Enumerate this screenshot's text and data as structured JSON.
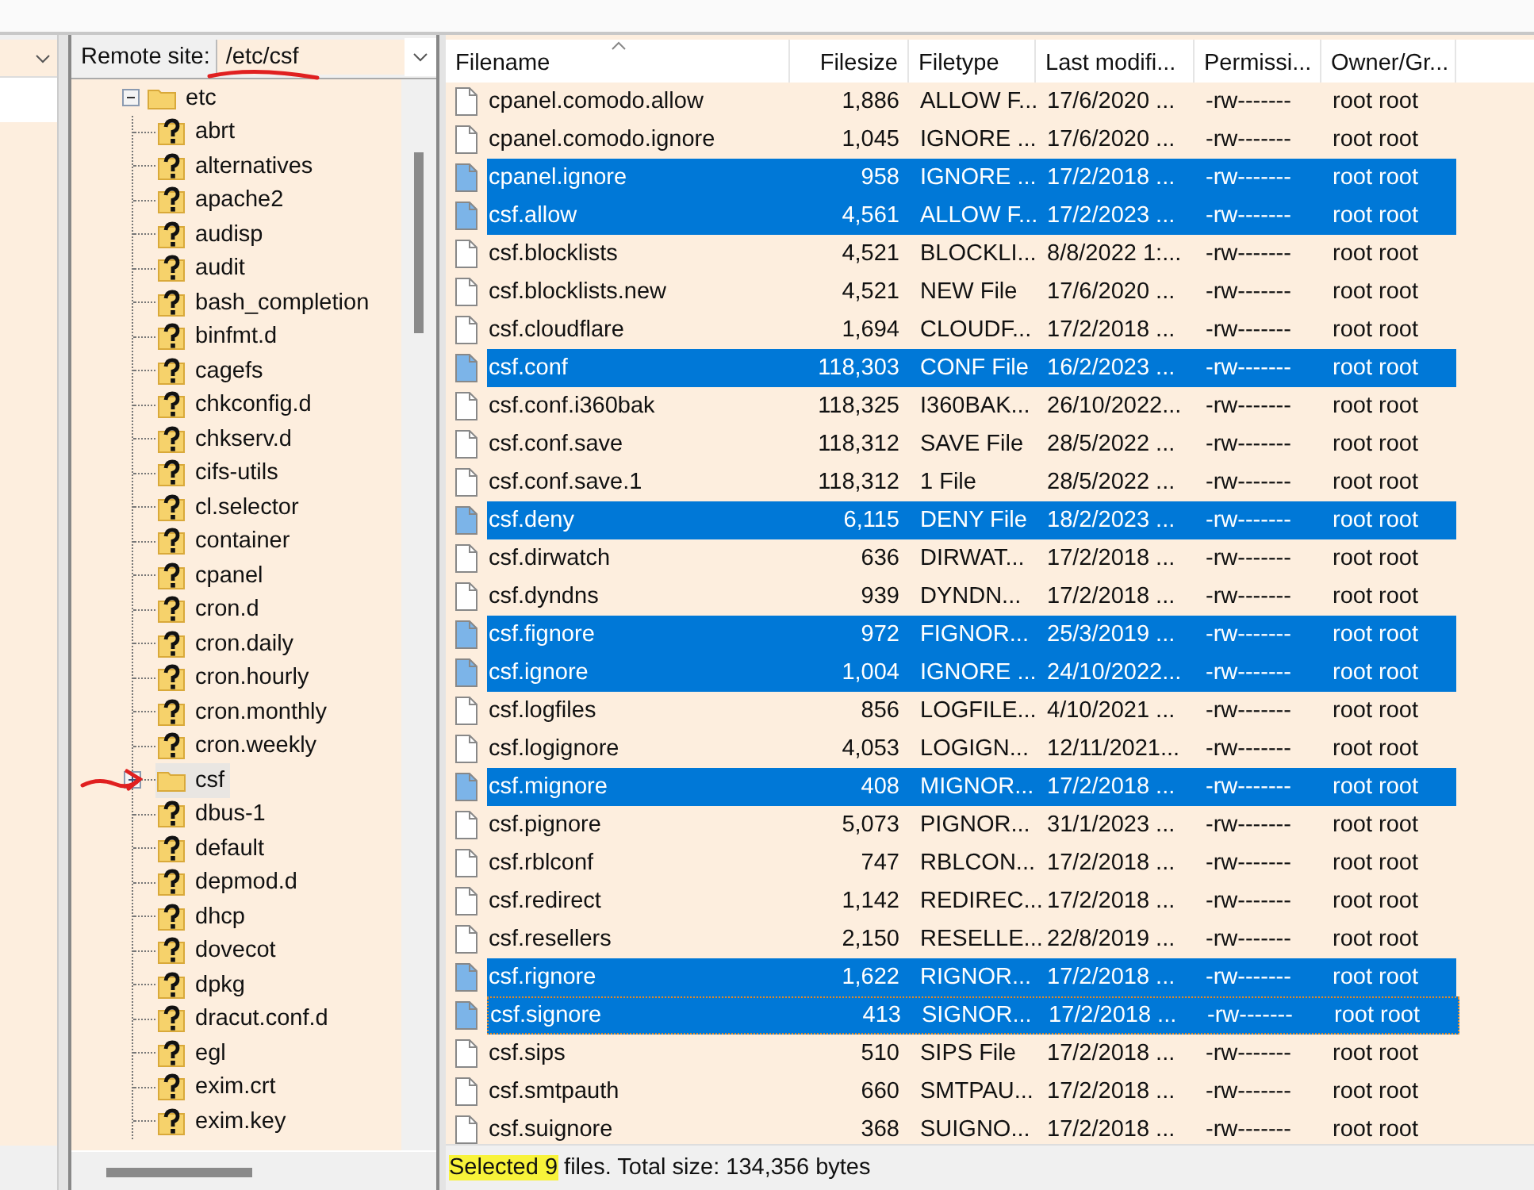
{
  "remote_panel": {
    "label": "Remote site:",
    "path": "/etc/csf",
    "tree": [
      {
        "name": "etc",
        "kind": "folder",
        "expanded": true,
        "selected": false,
        "children": [
          {
            "name": "abrt",
            "kind": "unknown"
          },
          {
            "name": "alternatives",
            "kind": "unknown"
          },
          {
            "name": "apache2",
            "kind": "unknown"
          },
          {
            "name": "audisp",
            "kind": "unknown"
          },
          {
            "name": "audit",
            "kind": "unknown"
          },
          {
            "name": "bash_completion",
            "kind": "unknown"
          },
          {
            "name": "binfmt.d",
            "kind": "unknown"
          },
          {
            "name": "cagefs",
            "kind": "unknown"
          },
          {
            "name": "chkconfig.d",
            "kind": "unknown"
          },
          {
            "name": "chkserv.d",
            "kind": "unknown"
          },
          {
            "name": "cifs-utils",
            "kind": "unknown"
          },
          {
            "name": "cl.selector",
            "kind": "unknown"
          },
          {
            "name": "container",
            "kind": "unknown"
          },
          {
            "name": "cpanel",
            "kind": "unknown"
          },
          {
            "name": "cron.d",
            "kind": "unknown"
          },
          {
            "name": "cron.daily",
            "kind": "unknown"
          },
          {
            "name": "cron.hourly",
            "kind": "unknown"
          },
          {
            "name": "cron.monthly",
            "kind": "unknown"
          },
          {
            "name": "cron.weekly",
            "kind": "unknown"
          },
          {
            "name": "csf",
            "kind": "folder",
            "expanded": false,
            "selected": true
          },
          {
            "name": "dbus-1",
            "kind": "unknown"
          },
          {
            "name": "default",
            "kind": "unknown"
          },
          {
            "name": "depmod.d",
            "kind": "unknown"
          },
          {
            "name": "dhcp",
            "kind": "unknown"
          },
          {
            "name": "dovecot",
            "kind": "unknown"
          },
          {
            "name": "dpkg",
            "kind": "unknown"
          },
          {
            "name": "dracut.conf.d",
            "kind": "unknown"
          },
          {
            "name": "egl",
            "kind": "unknown"
          },
          {
            "name": "exim.crt",
            "kind": "unknown"
          },
          {
            "name": "exim.key",
            "kind": "unknown"
          }
        ]
      }
    ]
  },
  "file_table": {
    "columns": [
      "Filename",
      "Filesize",
      "Filetype",
      "Last modifi...",
      "Permissi...",
      "Owner/Gr..."
    ],
    "rows": [
      {
        "cells": [
          "cpanel.comodo.allow",
          "1,886",
          "ALLOW F...",
          "17/6/2020 ...",
          "-rw-------",
          "root root"
        ],
        "selected": false
      },
      {
        "cells": [
          "cpanel.comodo.ignore",
          "1,045",
          "IGNORE ...",
          "17/6/2020 ...",
          "-rw-------",
          "root root"
        ],
        "selected": false
      },
      {
        "cells": [
          "cpanel.ignore",
          "958",
          "IGNORE ...",
          "17/2/2018 ...",
          "-rw-------",
          "root root"
        ],
        "selected": true
      },
      {
        "cells": [
          "csf.allow",
          "4,561",
          "ALLOW F...",
          "17/2/2023 ...",
          "-rw-------",
          "root root"
        ],
        "selected": true
      },
      {
        "cells": [
          "csf.blocklists",
          "4,521",
          "BLOCKLI...",
          "8/8/2022 1:...",
          "-rw-------",
          "root root"
        ],
        "selected": false
      },
      {
        "cells": [
          "csf.blocklists.new",
          "4,521",
          "NEW File",
          "17/6/2020 ...",
          "-rw-------",
          "root root"
        ],
        "selected": false
      },
      {
        "cells": [
          "csf.cloudflare",
          "1,694",
          "CLOUDF...",
          "17/2/2018 ...",
          "-rw-------",
          "root root"
        ],
        "selected": false
      },
      {
        "cells": [
          "csf.conf",
          "118,303",
          "CONF File",
          "16/2/2023 ...",
          "-rw-------",
          "root root"
        ],
        "selected": true
      },
      {
        "cells": [
          "csf.conf.i360bak",
          "118,325",
          "I360BAK...",
          "26/10/2022...",
          "-rw-------",
          "root root"
        ],
        "selected": false
      },
      {
        "cells": [
          "csf.conf.save",
          "118,312",
          "SAVE File",
          "28/5/2022 ...",
          "-rw-------",
          "root root"
        ],
        "selected": false
      },
      {
        "cells": [
          "csf.conf.save.1",
          "118,312",
          "1 File",
          "28/5/2022 ...",
          "-rw-------",
          "root root"
        ],
        "selected": false
      },
      {
        "cells": [
          "csf.deny",
          "6,115",
          "DENY File",
          "18/2/2023 ...",
          "-rw-------",
          "root root"
        ],
        "selected": true
      },
      {
        "cells": [
          "csf.dirwatch",
          "636",
          "DIRWAT...",
          "17/2/2018 ...",
          "-rw-------",
          "root root"
        ],
        "selected": false
      },
      {
        "cells": [
          "csf.dyndns",
          "939",
          "DYNDN...",
          "17/2/2018 ...",
          "-rw-------",
          "root root"
        ],
        "selected": false
      },
      {
        "cells": [
          "csf.fignore",
          "972",
          "FIGNOR...",
          "25/3/2019 ...",
          "-rw-------",
          "root root"
        ],
        "selected": true
      },
      {
        "cells": [
          "csf.ignore",
          "1,004",
          "IGNORE ...",
          "24/10/2022...",
          "-rw-------",
          "root root"
        ],
        "selected": true
      },
      {
        "cells": [
          "csf.logfiles",
          "856",
          "LOGFILE...",
          "4/10/2021 ...",
          "-rw-------",
          "root root"
        ],
        "selected": false
      },
      {
        "cells": [
          "csf.logignore",
          "4,053",
          "LOGIGN...",
          "12/11/2021...",
          "-rw-------",
          "root root"
        ],
        "selected": false
      },
      {
        "cells": [
          "csf.mignore",
          "408",
          "MIGNOR...",
          "17/2/2018 ...",
          "-rw-------",
          "root root"
        ],
        "selected": true
      },
      {
        "cells": [
          "csf.pignore",
          "5,073",
          "PIGNOR...",
          "31/1/2023 ...",
          "-rw-------",
          "root root"
        ],
        "selected": false
      },
      {
        "cells": [
          "csf.rblconf",
          "747",
          "RBLCON...",
          "17/2/2018 ...",
          "-rw-------",
          "root root"
        ],
        "selected": false
      },
      {
        "cells": [
          "csf.redirect",
          "1,142",
          "REDIREC...",
          "17/2/2018 ...",
          "-rw-------",
          "root root"
        ],
        "selected": false
      },
      {
        "cells": [
          "csf.resellers",
          "2,150",
          "RESELLE...",
          "22/8/2019 ...",
          "-rw-------",
          "root root"
        ],
        "selected": false
      },
      {
        "cells": [
          "csf.rignore",
          "1,622",
          "RIGNOR...",
          "17/2/2018 ...",
          "-rw-------",
          "root root"
        ],
        "selected": true
      },
      {
        "cells": [
          "csf.signore",
          "413",
          "SIGNOR...",
          "17/2/2018 ...",
          "-rw-------",
          "root root"
        ],
        "selected": true,
        "focused": true
      },
      {
        "cells": [
          "csf.sips",
          "510",
          "SIPS File",
          "17/2/2018 ...",
          "-rw-------",
          "root root"
        ],
        "selected": false
      },
      {
        "cells": [
          "csf.smtpauth",
          "660",
          "SMTPAU...",
          "17/2/2018 ...",
          "-rw-------",
          "root root"
        ],
        "selected": false
      },
      {
        "cells": [
          "csf.suignore",
          "368",
          "SUIGNO...",
          "17/2/2018 ...",
          "-rw-------",
          "root root"
        ],
        "selected": false
      }
    ]
  },
  "status_bar": {
    "highlight": "Selected 9",
    "text": "files. Total size: 134,356 bytes"
  },
  "annotations": {
    "underline": {
      "color": "#e02020"
    },
    "arrow": {
      "color": "#e02020"
    }
  }
}
